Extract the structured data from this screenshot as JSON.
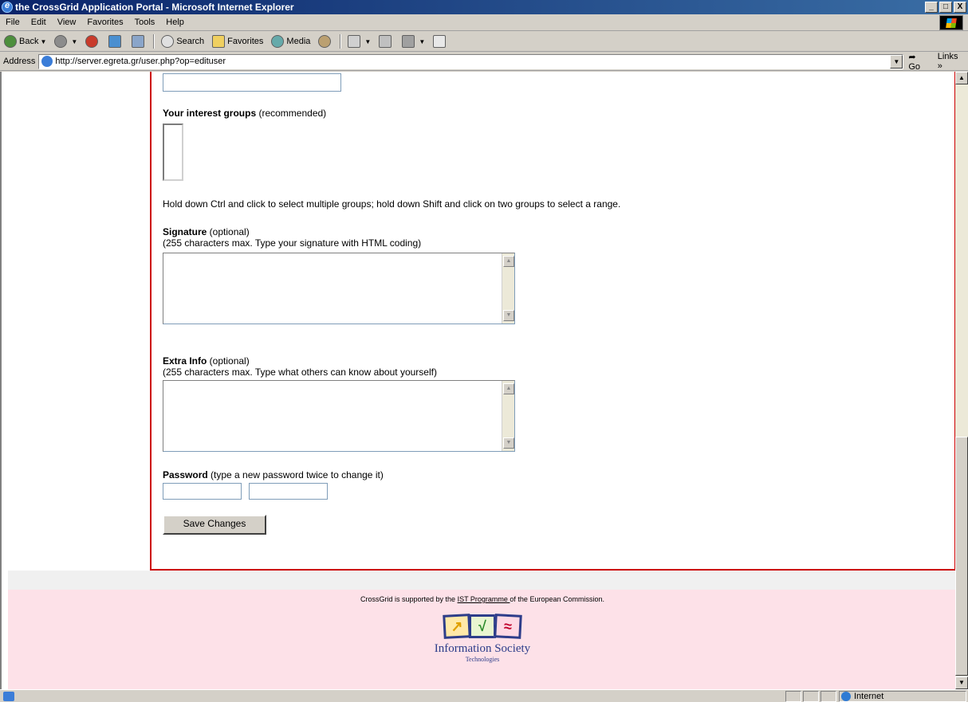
{
  "window": {
    "title": "the CrossGrid Application Portal - Microsoft Internet Explorer",
    "minimize": "_",
    "maximize": "□",
    "close": "X"
  },
  "menu": [
    "File",
    "Edit",
    "View",
    "Favorites",
    "Tools",
    "Help"
  ],
  "toolbar": {
    "back": "Back",
    "search": "Search",
    "favorites": "Favorites",
    "media": "Media"
  },
  "address": {
    "label": "Address",
    "url": "http://server.egreta.gr/user.php?op=edituser",
    "go": "Go",
    "links": "Links »"
  },
  "form": {
    "interest_label": "Your interest groups",
    "interest_hint": " (recommended)",
    "multi_help": "Hold down Ctrl and click to select multiple groups; hold down Shift and click on two groups to select a range.",
    "signature_label": "Signature",
    "signature_hint": " (optional)",
    "signature_note": "(255 characters max. Type your signature with HTML coding)",
    "extra_label": "Extra Info",
    "extra_hint": " (optional)",
    "extra_note": "(255 characters max. Type what others can know about yourself)",
    "password_label": "Password",
    "password_hint": " (type a new password twice to change it)",
    "save_button": "Save Changes"
  },
  "footer": {
    "support_pre": "CrossGrid is supported by the ",
    "support_link": "IST Programme ",
    "support_post": "of the European Commission.",
    "logo_title": "Information Society",
    "logo_sub": "Technologies"
  },
  "status": {
    "zone": "Internet"
  }
}
